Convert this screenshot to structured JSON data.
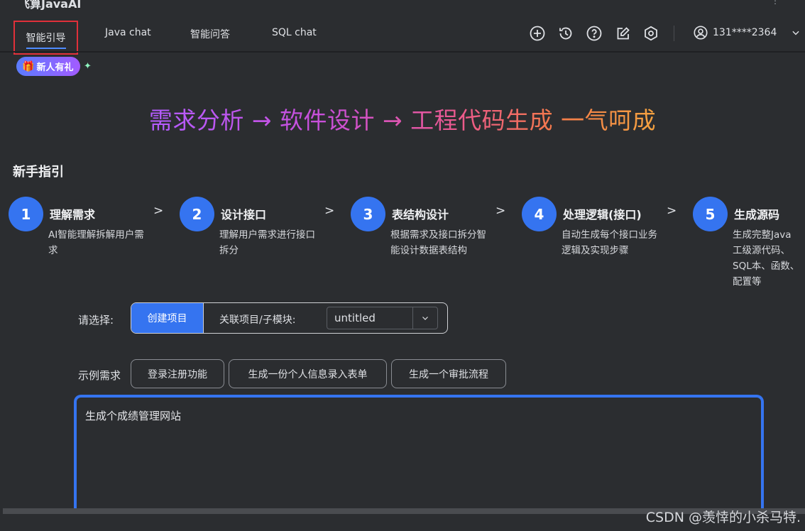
{
  "app": {
    "title": "飞算JavaAI",
    "menu_icon": "more-icon"
  },
  "nav": {
    "tabs": [
      {
        "label": "智能引导",
        "active": true
      },
      {
        "label": "Java chat"
      },
      {
        "label": "智能问答"
      },
      {
        "label": "SQL chat"
      }
    ],
    "icons": [
      "add-icon",
      "history-icon",
      "help-icon",
      "edit-icon",
      "settings-icon"
    ],
    "user": "131****2364"
  },
  "badge": {
    "label": "新人有礼",
    "icon": "gift-icon"
  },
  "hero": {
    "text": "需求分析 → 软件设计 → 工程代码生成 一气呵成"
  },
  "guide": {
    "title": "新手指引",
    "steps": [
      {
        "num": "1",
        "title": "理解需求",
        "desc": "AI智能理解拆解用户需求"
      },
      {
        "num": "2",
        "title": "设计接口",
        "desc": "理解用户需求进行接口拆分"
      },
      {
        "num": "3",
        "title": "表结构设计",
        "desc": "根据需求及接口拆分智能设计数据表结构"
      },
      {
        "num": "4",
        "title": "处理逻辑(接口)",
        "desc": "自动生成每个接口业务逻辑及实现步骤"
      },
      {
        "num": "5",
        "title": "生成源码",
        "desc": "生成完整Java 工级源代码、SQL本、函数、配置等"
      }
    ],
    "separator": ">"
  },
  "select": {
    "label": "请选择:",
    "create_label": "创建项目",
    "link_label": "关联项目/子模块:",
    "dropdown_value": "untitled"
  },
  "examples": {
    "label": "示例需求",
    "chips": [
      "登录注册功能",
      "生成一份个人信息录入表单",
      "生成一个审批流程"
    ]
  },
  "input": {
    "value": "生成个成绩管理网站"
  },
  "watermark": "CSDN @羡悻的小杀马特."
}
